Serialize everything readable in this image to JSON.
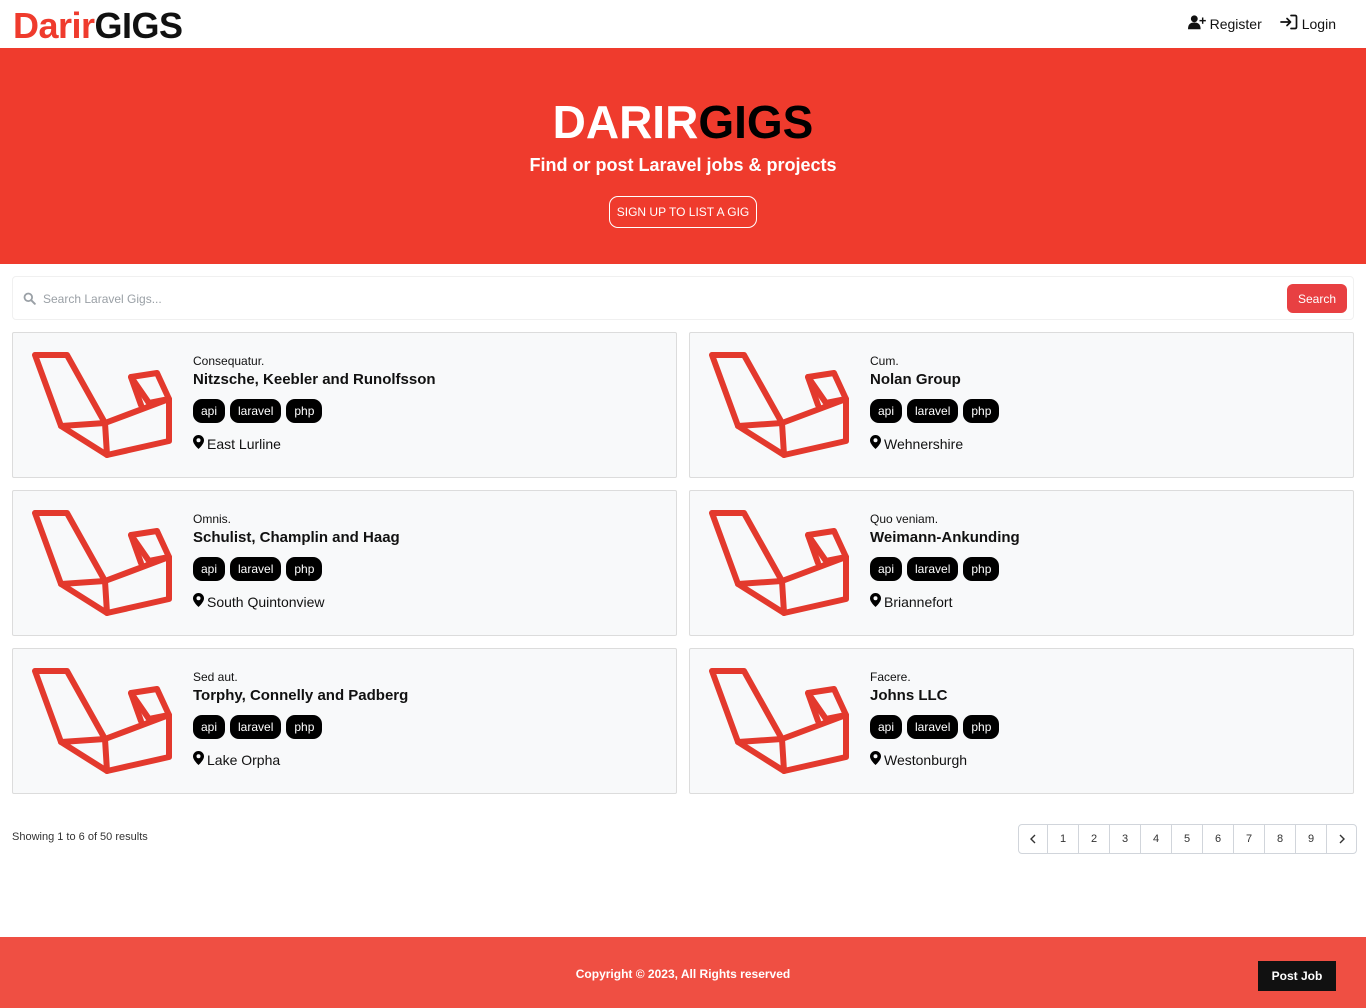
{
  "header": {
    "logo_part1": "Darir",
    "logo_part2": "GIGS",
    "register_label": "Register",
    "login_label": "Login"
  },
  "hero": {
    "title_part1": "DARIR",
    "title_part2": "GIGS",
    "subtitle": "Find or post Laravel jobs & projects",
    "cta_label": "SIGN UP TO LIST A GIG"
  },
  "search": {
    "placeholder": "Search Laravel Gigs...",
    "button_label": "Search"
  },
  "gigs": [
    {
      "subtitle": "Consequatur.",
      "company": "Nitzsche, Keebler and Runolfsson",
      "tags": [
        "api",
        "laravel",
        "php"
      ],
      "location": "East Lurline"
    },
    {
      "subtitle": "Cum.",
      "company": "Nolan Group",
      "tags": [
        "api",
        "laravel",
        "php"
      ],
      "location": "Wehnershire"
    },
    {
      "subtitle": "Omnis.",
      "company": "Schulist, Champlin and Haag",
      "tags": [
        "api",
        "laravel",
        "php"
      ],
      "location": "South Quintonview"
    },
    {
      "subtitle": "Quo veniam.",
      "company": "Weimann-Ankunding",
      "tags": [
        "api",
        "laravel",
        "php"
      ],
      "location": "Briannefort"
    },
    {
      "subtitle": "Sed aut.",
      "company": "Torphy, Connelly and Padberg",
      "tags": [
        "api",
        "laravel",
        "php"
      ],
      "location": "Lake Orpha"
    },
    {
      "subtitle": "Facere.",
      "company": "Johns LLC",
      "tags": [
        "api",
        "laravel",
        "php"
      ],
      "location": "Westonburgh"
    }
  ],
  "pagination": {
    "showing_text": "Showing 1 to 6 of 50 results",
    "pages": [
      "1",
      "2",
      "3",
      "4",
      "5",
      "6",
      "7",
      "8",
      "9"
    ]
  },
  "footer": {
    "copyright": "Copyright © 2023, All Rights reserved",
    "post_job_label": "Post Job"
  },
  "colors": {
    "brand_red": "#ef3b2d",
    "tag_bg": "#000000"
  }
}
